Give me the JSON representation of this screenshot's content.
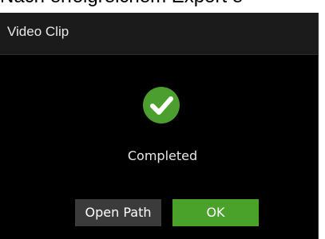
{
  "background": {
    "caption": "Nach erfolgreichem Export e"
  },
  "dialog": {
    "title": "Video Clip",
    "status": {
      "icon": "check-circle-icon",
      "text": "Completed",
      "color": "#4c9f2f"
    },
    "buttons": {
      "open_path_label": "Open Path",
      "ok_label": "OK"
    }
  },
  "colors": {
    "dialog_background": "#000000",
    "titlebar_background": "#1b1b1b",
    "ok_button": "#4aa22a",
    "open_path_button": "#3b3b3b"
  }
}
